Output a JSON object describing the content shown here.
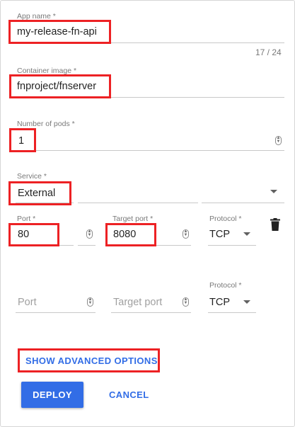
{
  "form": {
    "app_name": {
      "label": "App name *",
      "value": "my-release-fn-api",
      "counter": "17 / 24"
    },
    "container_image": {
      "label": "Container image *",
      "value": "fnproject/fnserver"
    },
    "pods": {
      "label": "Number of pods *",
      "value": "1"
    },
    "service": {
      "label": "Service *",
      "value": "External"
    },
    "port_row_1": {
      "port_label": "Port *",
      "port_value": "80",
      "target_label": "Target port *",
      "target_value": "8080",
      "protocol_label": "Protocol *",
      "protocol_value": "TCP"
    },
    "port_row_2": {
      "port_placeholder": "Port",
      "target_placeholder": "Target port",
      "protocol_label": "Protocol *",
      "protocol_value": "TCP"
    },
    "advanced_label": "SHOW ADVANCED OPTIONS",
    "deploy_label": "DEPLOY",
    "cancel_label": "CANCEL"
  },
  "colors": {
    "accent": "#326de6",
    "highlight": "#ed2124"
  },
  "icons": [
    "spinner-arrows-icon",
    "dropdown-caret-icon",
    "trash-icon"
  ]
}
